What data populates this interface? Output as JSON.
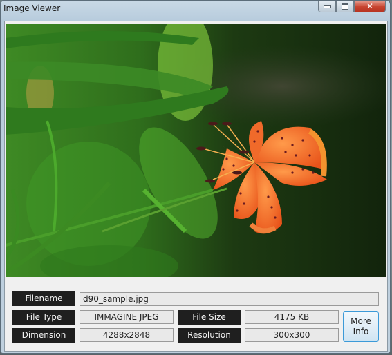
{
  "window": {
    "title": "Image Viewer",
    "controls": {
      "minimize": "▭",
      "maximize": "□",
      "close": "✕"
    }
  },
  "image": {
    "description": "Orange spotted tiger lily flower against blurred green foliage"
  },
  "info": {
    "filename_label": "Filename",
    "filename_value": "d90_sample.jpg",
    "filetype_label": "File Type",
    "filetype_value": "IMMAGINE JPEG",
    "filesize_label": "File Size",
    "filesize_value": "4175 KB",
    "dimension_label": "Dimension",
    "dimension_value": "4288x2848",
    "resolution_label": "Resolution",
    "resolution_value": "300x300",
    "more_info_line1": "More",
    "more_info_line2": "Info"
  },
  "colors": {
    "label_bg": "#1f1f1f",
    "value_bg": "#e9e9e9",
    "button_border": "#3c9ad8",
    "close_red": "#c7432f"
  }
}
